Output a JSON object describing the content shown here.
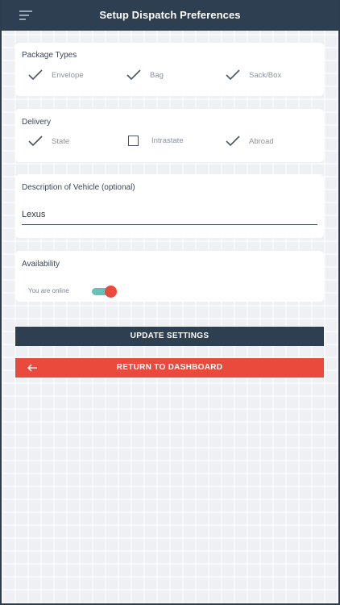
{
  "appbar": {
    "title": "Setup Dispatch Preferences",
    "menu_icon": "hamburger-menu-icon"
  },
  "package_types": {
    "title": "Package Types",
    "options": [
      {
        "label": "Envelope",
        "checked": true
      },
      {
        "label": "Bag",
        "checked": true
      },
      {
        "label": "Sack/Box",
        "checked": true
      }
    ]
  },
  "delivery": {
    "title": "Delivery",
    "options": [
      {
        "label": "State",
        "checked": true
      },
      {
        "label": "Intrastate",
        "checked": false
      },
      {
        "label": "Abroad",
        "checked": true
      }
    ]
  },
  "vehicle": {
    "label": "Description of Vehicle (optional)",
    "value": "Lexus"
  },
  "availability": {
    "title": "Availability",
    "status_text": "You are online",
    "online": true
  },
  "buttons": {
    "update_label": "UPDATE SETTINGS",
    "return_label": "RETURN TO DASHBOARD"
  },
  "colors": {
    "primary": "#2f3f52",
    "accent": "#ea4a3b",
    "toggle_track": "#66c2b6",
    "background": "#eef0f4"
  }
}
